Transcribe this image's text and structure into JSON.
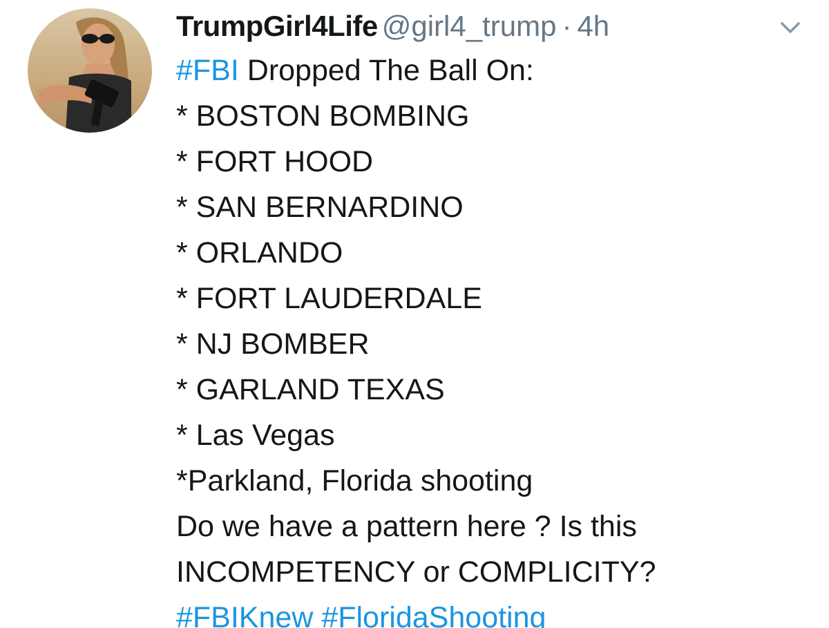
{
  "tweet": {
    "author": {
      "display_name": "TrumpGirl4Life",
      "handle": "@girl4_trump",
      "separator": "·",
      "time": "4h"
    },
    "menu_icon": "chevron-down-icon",
    "avatar_icon": "profile-photo",
    "first_line": {
      "hashtag": "#FBI",
      "text": " Dropped The Ball On:"
    },
    "list_items": [
      "* BOSTON BOMBING",
      "* FORT HOOD",
      "* SAN BERNARDINO",
      "* ORLANDO",
      "* FORT LAUDERDALE",
      "* NJ BOMBER",
      "* GARLAND TEXAS",
      "* Las Vegas",
      "*Parkland, Florida shooting"
    ],
    "closing_lines": [
      "Do we have a pattern here ? Is this",
      "INCOMPETENCY or COMPLICITY?"
    ],
    "hashtags": [
      "#FBIKnew",
      "#FloridaShooting"
    ],
    "colors": {
      "link": "#1b95e0",
      "text": "#14171a",
      "secondary": "#657786"
    }
  }
}
